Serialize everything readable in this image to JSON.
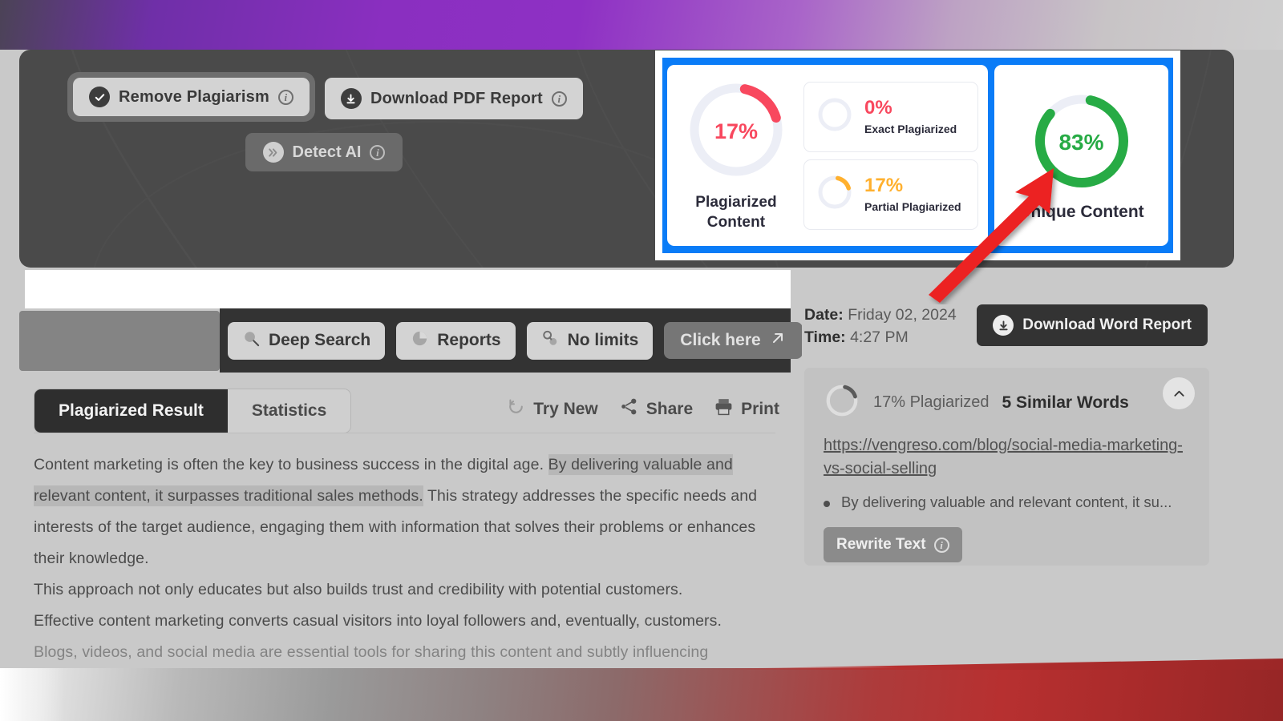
{
  "hero": {
    "buttons": [
      {
        "label": "Remove Plagiarism",
        "icon": "check-circle-icon",
        "state": "focused"
      },
      {
        "label": "Download PDF Report",
        "icon": "download-circle-icon",
        "state": "normal"
      },
      {
        "label": "Detect AI",
        "icon": "double-chevron-right-icon",
        "state": "disabled"
      }
    ],
    "info_glyph": "i"
  },
  "stats": {
    "highlight_color": "#0a7cf7",
    "plagiarized": {
      "percent": "17%",
      "caption_line1": "Plagiarized",
      "caption_line2": "Content",
      "color": "#f8485e",
      "value": 17
    },
    "exact": {
      "percent": "0%",
      "label": "Exact Plagiarized",
      "color": "#f8485e",
      "value": 0
    },
    "partial": {
      "percent": "17%",
      "label": "Partial Plagiarized",
      "color": "#ffb02e",
      "value": 17
    },
    "unique": {
      "percent": "83%",
      "caption": "Unique Content",
      "color": "#27ab45",
      "value": 83
    }
  },
  "toolbar": {
    "items": [
      {
        "label": "Deep Search",
        "icon": "magnifier-icon",
        "style": "light"
      },
      {
        "label": "Reports",
        "icon": "pie-chart-icon",
        "style": "light"
      },
      {
        "label": "No limits",
        "icon": "infinity-icon",
        "style": "light"
      },
      {
        "label": "Click here",
        "icon": "arrow-up-right-icon",
        "style": "ghost"
      }
    ]
  },
  "tabs": [
    {
      "label": "Plagiarized Result",
      "active": true
    },
    {
      "label": "Statistics",
      "active": false
    }
  ],
  "tab_actions": [
    {
      "label": "Try New",
      "icon": "refresh-icon"
    },
    {
      "label": "Share",
      "icon": "share-nodes-icon"
    },
    {
      "label": "Print",
      "icon": "printer-icon"
    }
  ],
  "content": {
    "paragraphs": [
      {
        "segments": [
          {
            "text": "Content marketing is often the key to business success in the digital age. ",
            "highlighted": false
          },
          {
            "text": "By delivering valuable and relevant content, it surpasses traditional sales methods.",
            "highlighted": true
          },
          {
            "text": " This strategy addresses the specific needs and interests of the target audience, engaging them with information that solves their problems or enhances their knowledge.",
            "highlighted": false
          }
        ]
      },
      {
        "segments": [
          {
            "text": "This approach not only educates but also builds trust and credibility with potential customers.",
            "highlighted": false
          }
        ]
      },
      {
        "segments": [
          {
            "text": "Effective content marketing converts casual visitors into loyal followers and, eventually, customers.",
            "highlighted": false
          }
        ]
      },
      {
        "clipped": true,
        "segments": [
          {
            "text": "Blogs, videos, and social media are essential tools for sharing this content and subtly influencing",
            "highlighted": false
          }
        ]
      }
    ]
  },
  "report_meta": {
    "date_label": "Date:",
    "date_value": "Friday 02, 2024",
    "time_label": "Time:",
    "time_value": "4:27 PM",
    "download_word_label": "Download Word Report",
    "download_word_icon": "download-circle-icon"
  },
  "source": {
    "percent_text": "17% Plagiarized",
    "similar_words": "5 Similar Words",
    "url": "https://vengreso.com/blog/social-media-marketing-vs-social-selling",
    "snippet": "By delivering valuable and relevant content, it su...",
    "rewrite_label": "Rewrite Text",
    "collapse_icon": "chevron-up-icon"
  },
  "annotation": {
    "arrow_color": "#ec2222",
    "points_to": "unique-content-donut"
  }
}
